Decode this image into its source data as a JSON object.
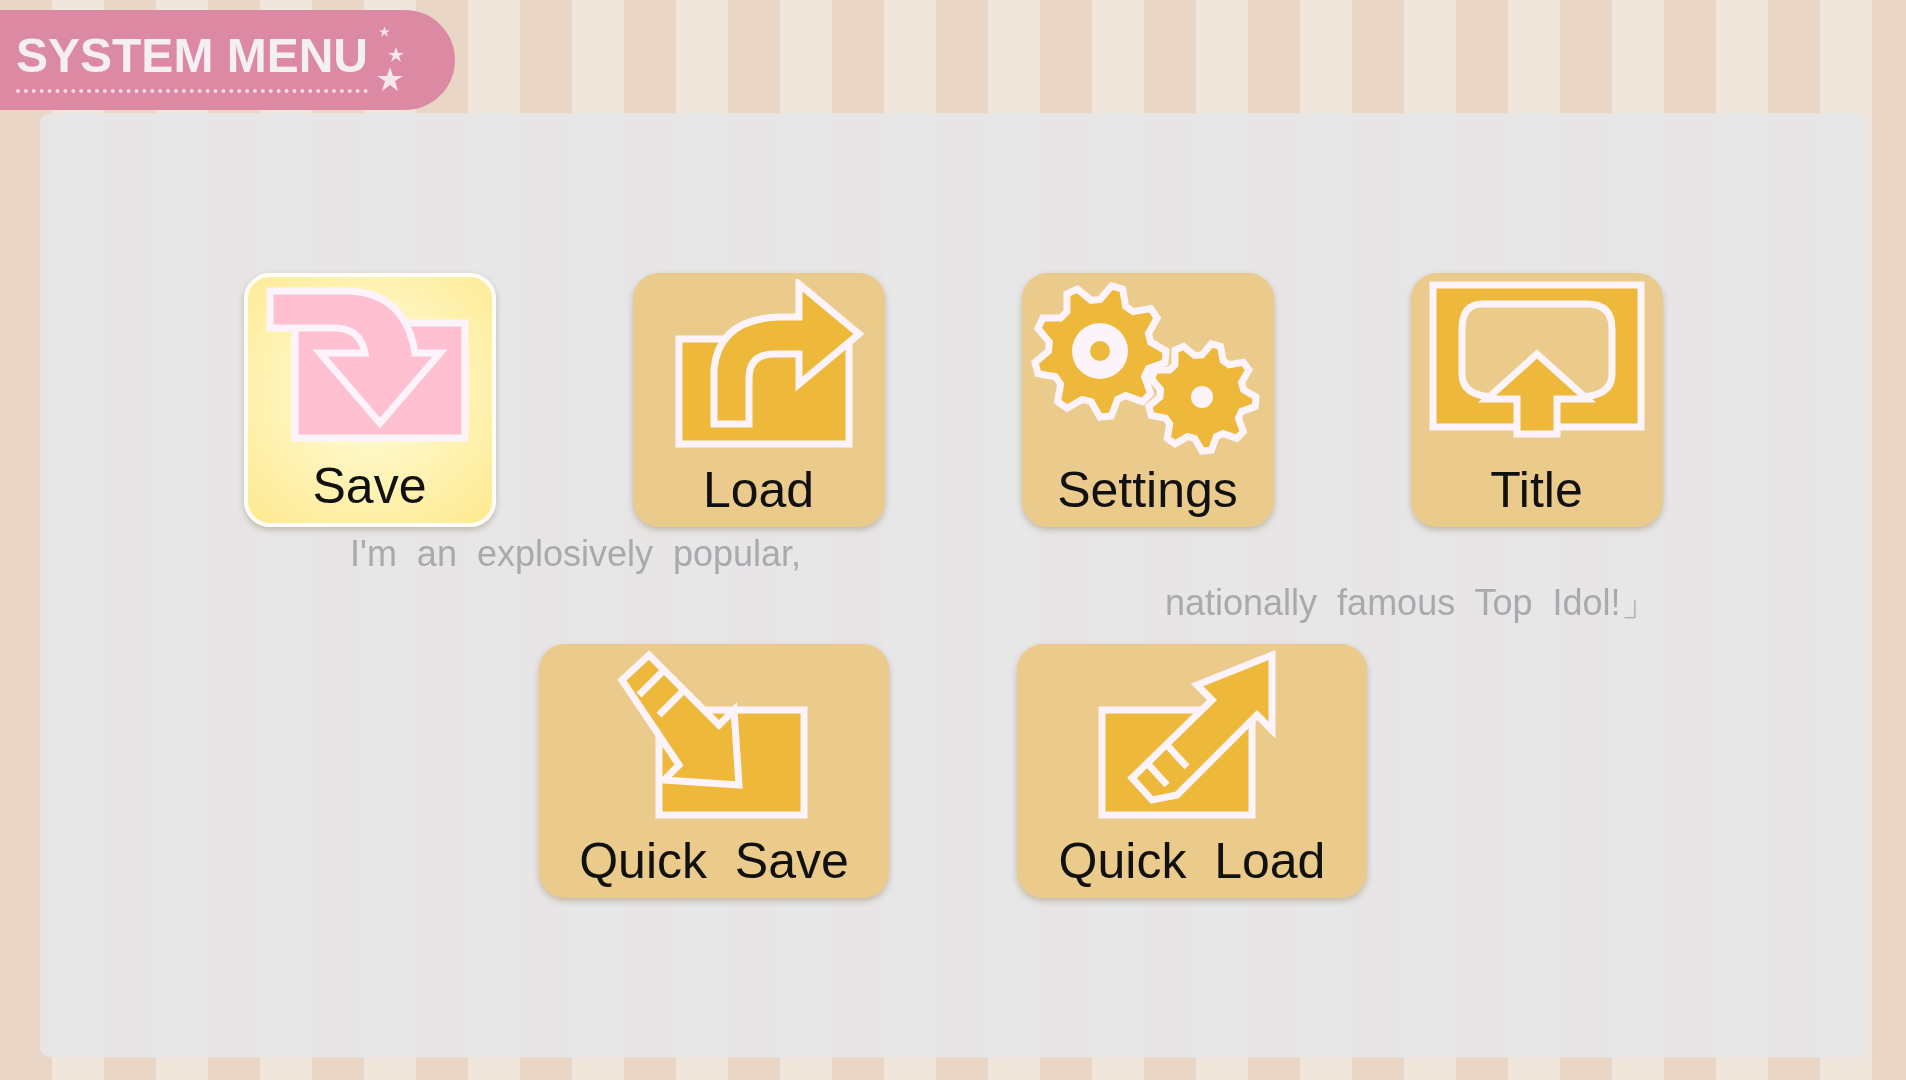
{
  "header": {
    "title": "SYSTEM MENU"
  },
  "rows": [
    {
      "buttons": [
        {
          "label": "Save",
          "kind": "save",
          "selected": true
        },
        {
          "label": "Load",
          "kind": "load",
          "selected": false
        },
        {
          "label": "Settings",
          "kind": "settings",
          "selected": false
        },
        {
          "label": "Title",
          "kind": "title",
          "selected": false
        }
      ]
    },
    {
      "buttons": [
        {
          "label": "Quick  Save",
          "kind": "quicksave",
          "selected": false
        },
        {
          "label": "Quick  Load",
          "kind": "quickload",
          "selected": false
        }
      ]
    }
  ],
  "background_dialogue": [
    "I'm an explosively popular,",
    "nationally famous Top Idol!」"
  ]
}
